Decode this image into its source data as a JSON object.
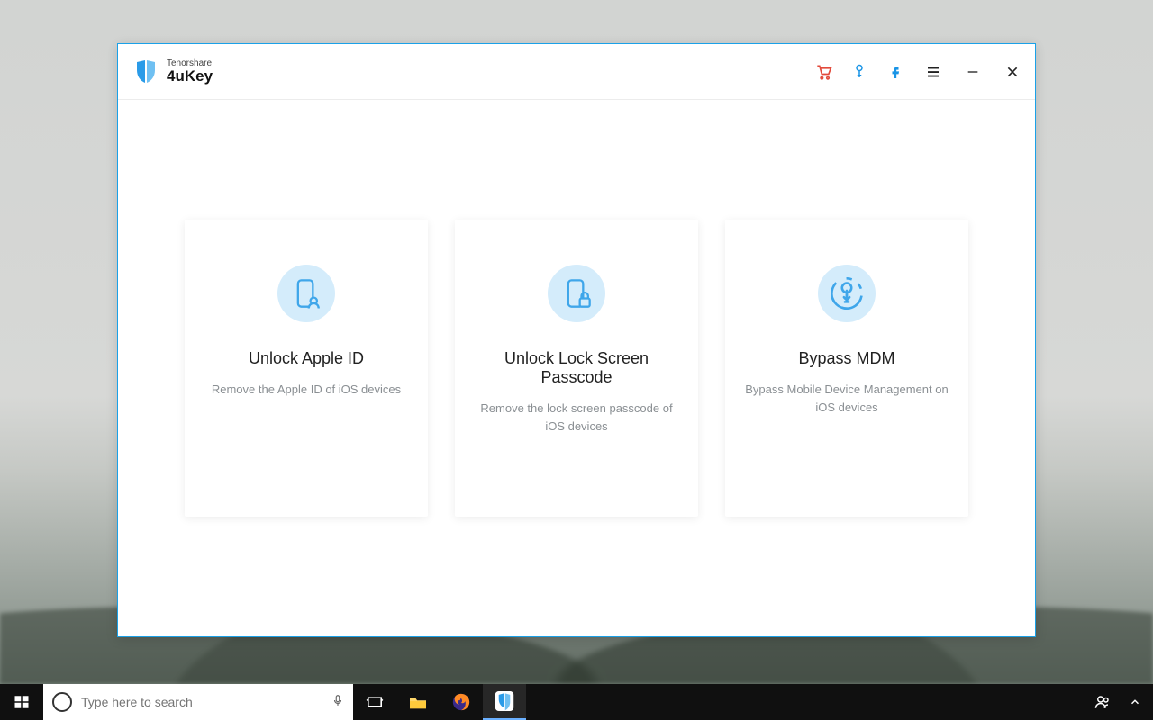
{
  "app": {
    "company": "Tenorshare",
    "product": "4uKey"
  },
  "titlebar": {
    "cart_icon": "cart-icon",
    "key_icon": "key-icon",
    "facebook_icon": "facebook-icon",
    "menu_icon": "menu-icon",
    "minimize_icon": "minimize-icon",
    "close_icon": "close-icon"
  },
  "cards": [
    {
      "title": "Unlock Apple ID",
      "desc": "Remove the Apple ID of iOS devices",
      "icon": "phone-user-icon"
    },
    {
      "title": "Unlock Lock Screen Passcode",
      "desc": "Remove the lock screen passcode of iOS devices",
      "icon": "phone-lock-icon"
    },
    {
      "title": "Bypass MDM",
      "desc": "Bypass Mobile Device Management on iOS devices",
      "icon": "mdm-key-icon"
    }
  ],
  "taskbar": {
    "search_placeholder": "Type here to search",
    "icons": {
      "start": "windows-start-icon",
      "cortana": "cortana-icon",
      "mic": "microphone-icon",
      "taskview": "task-view-icon",
      "explorer": "file-explorer-icon",
      "firefox": "firefox-icon",
      "app": "4ukey-app-icon",
      "people": "people-icon",
      "tray_chevron": "tray-chevron-up-icon"
    }
  }
}
